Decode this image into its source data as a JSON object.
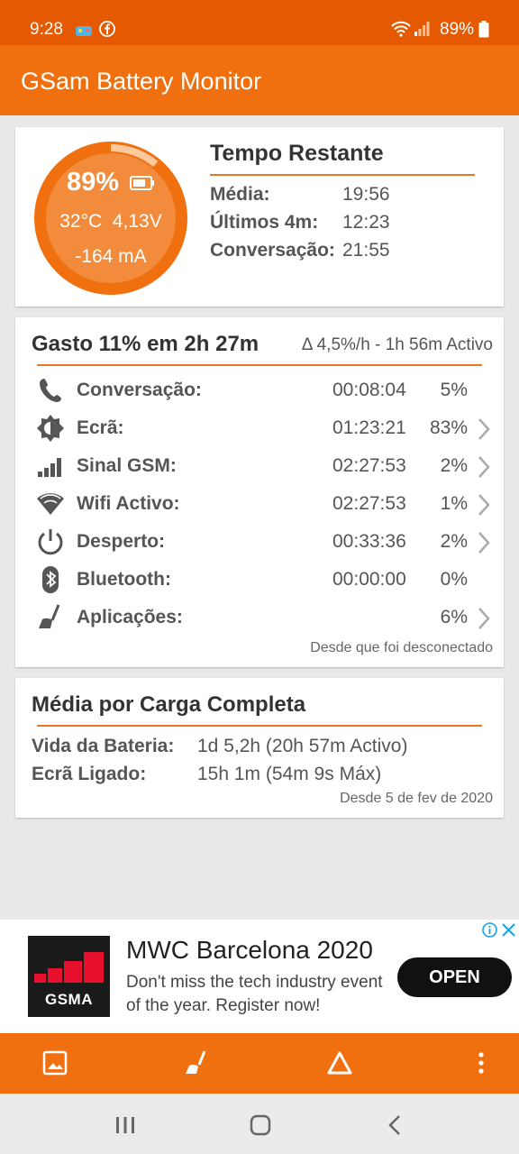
{
  "status_bar": {
    "time": "9:28",
    "battery": "89%",
    "icons": [
      "game-icon",
      "facebook-icon",
      "wifi-icon",
      "signal-icon",
      "battery-icon"
    ]
  },
  "app_bar": {
    "title": "GSam Battery Monitor"
  },
  "summary_card": {
    "gauge": {
      "percent": "89%",
      "level": 0.89,
      "temp": "32°C",
      "voltage": "4,13V",
      "current": "-164 mA"
    },
    "time_remaining": {
      "title": "Tempo Restante",
      "rows": [
        {
          "label": "Média:",
          "value": "19:56"
        },
        {
          "label": "Últimos 4m:",
          "value": "12:23"
        },
        {
          "label": "Conversação:",
          "value": "21:55"
        }
      ]
    }
  },
  "usage_card": {
    "title": "Gasto 11% em 2h 27m",
    "rate": "Δ 4,5%/h - 1h 56m Activo",
    "rows": [
      {
        "icon": "phone-icon",
        "label": "Conversação:",
        "time": "00:08:04",
        "percent": "5%"
      },
      {
        "icon": "brightness-icon",
        "label": "Ecrã:",
        "time": "01:23:21",
        "percent": "83%"
      },
      {
        "icon": "cell-signal-icon",
        "label": "Sinal GSM:",
        "time": "02:27:53",
        "percent": "2%"
      },
      {
        "icon": "wifi-icon",
        "label": "Wifi Activo:",
        "time": "02:27:53",
        "percent": "1%"
      },
      {
        "icon": "power-icon",
        "label": "Desperto:",
        "time": "00:33:36",
        "percent": "2%"
      },
      {
        "icon": "bluetooth-icon",
        "label": "Bluetooth:",
        "time": "00:00:00",
        "percent": "0%"
      },
      {
        "icon": "broom-icon",
        "label": "Aplicações:",
        "time": "",
        "percent": "6%"
      }
    ],
    "footer": "Desde que foi desconectado"
  },
  "average_card": {
    "title": "Média por Carga Completa",
    "rows": [
      {
        "label": "Vida da Bateria:",
        "value": "1d 5,2h (20h 57m Activo)"
      },
      {
        "label": "Ecrã Ligado:",
        "value": "15h 1m (54m 9s Máx)"
      }
    ],
    "footer": "Desde 5 de fev de 2020"
  },
  "ad": {
    "logo_text": "GSMA",
    "title": "MWC Barcelona 2020",
    "description": "Don't miss the tech industry event of the year. Register now!",
    "button": "OPEN"
  },
  "colors": {
    "primary": "#f07010",
    "status": "#e55a00",
    "accent_line": "#e3782a"
  }
}
